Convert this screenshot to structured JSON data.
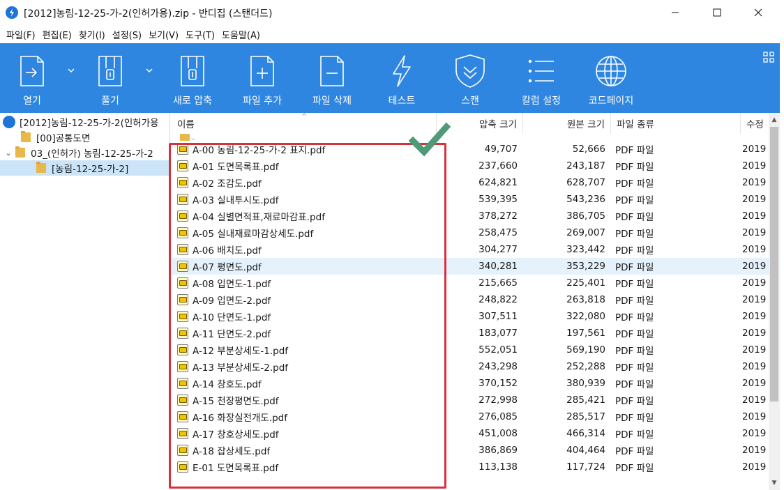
{
  "window": {
    "title": "[2012]농림-12-25-가-2(인허가용).zip - 반디집 (스탠더드)"
  },
  "menu": [
    "파일(F)",
    "편집(E)",
    "찾기(I)",
    "설정(S)",
    "보기(V)",
    "도구(T)",
    "도움말(A)"
  ],
  "toolbar": {
    "open": "열기",
    "extract": "풀기",
    "new_archive": "새로 압축",
    "add_file": "파일 추가",
    "delete_file": "파일 삭제",
    "test": "테스트",
    "scan": "스캔",
    "column_settings": "칼럼 설정",
    "codepage": "코드페이지"
  },
  "tree": {
    "root": "[2012]농림-12-25-가-2(인허가용",
    "items": [
      "[00]공통도면",
      "03_(인허가) 농림-12-25-가-2",
      "[농림-12-25-가-2]"
    ]
  },
  "columns": {
    "name": "이름",
    "compressed": "압축 크기",
    "original": "원본 크기",
    "type": "파일 종류",
    "modified": "수정"
  },
  "parent_label": "..",
  "files": [
    {
      "name": "A-00 농림-12-25-가-2 표지.pdf",
      "comp": "49,707",
      "orig": "52,666",
      "type": "PDF 파일",
      "mod": "2019"
    },
    {
      "name": "A-01 도면목록표.pdf",
      "comp": "237,660",
      "orig": "243,187",
      "type": "PDF 파일",
      "mod": "2019"
    },
    {
      "name": "A-02 조감도.pdf",
      "comp": "624,821",
      "orig": "628,707",
      "type": "PDF 파일",
      "mod": "2019"
    },
    {
      "name": "A-03 실내투시도.pdf",
      "comp": "539,395",
      "orig": "543,236",
      "type": "PDF 파일",
      "mod": "2019"
    },
    {
      "name": "A-04 실별면적표,재료마감표.pdf",
      "comp": "378,272",
      "orig": "386,705",
      "type": "PDF 파일",
      "mod": "2019"
    },
    {
      "name": "A-05 실내재료마감상세도.pdf",
      "comp": "258,475",
      "orig": "269,007",
      "type": "PDF 파일",
      "mod": "2019"
    },
    {
      "name": "A-06 배치도.pdf",
      "comp": "304,277",
      "orig": "323,442",
      "type": "PDF 파일",
      "mod": "2019"
    },
    {
      "name": "A-07 평면도.pdf",
      "comp": "340,281",
      "orig": "353,229",
      "type": "PDF 파일",
      "mod": "2019"
    },
    {
      "name": "A-08 입면도-1.pdf",
      "comp": "215,665",
      "orig": "225,401",
      "type": "PDF 파일",
      "mod": "2019"
    },
    {
      "name": "A-09 입면도-2.pdf",
      "comp": "248,822",
      "orig": "263,818",
      "type": "PDF 파일",
      "mod": "2019"
    },
    {
      "name": "A-10 단면도-1.pdf",
      "comp": "307,511",
      "orig": "322,080",
      "type": "PDF 파일",
      "mod": "2019"
    },
    {
      "name": "A-11 단면도-2.pdf",
      "comp": "183,077",
      "orig": "197,561",
      "type": "PDF 파일",
      "mod": "2019"
    },
    {
      "name": "A-12 부분상세도-1.pdf",
      "comp": "552,051",
      "orig": "569,190",
      "type": "PDF 파일",
      "mod": "2019"
    },
    {
      "name": "A-13 부분상세도-2.pdf",
      "comp": "243,298",
      "orig": "252,288",
      "type": "PDF 파일",
      "mod": "2019"
    },
    {
      "name": "A-14 창호도.pdf",
      "comp": "370,152",
      "orig": "380,939",
      "type": "PDF 파일",
      "mod": "2019"
    },
    {
      "name": "A-15 천장평면도.pdf",
      "comp": "272,998",
      "orig": "285,421",
      "type": "PDF 파일",
      "mod": "2019"
    },
    {
      "name": "A-16 화장실전개도.pdf",
      "comp": "276,085",
      "orig": "285,517",
      "type": "PDF 파일",
      "mod": "2019"
    },
    {
      "name": "A-17 창호상세도.pdf",
      "comp": "451,008",
      "orig": "466,314",
      "type": "PDF 파일",
      "mod": "2019"
    },
    {
      "name": "A-18 잡상세도.pdf",
      "comp": "386,869",
      "orig": "404,464",
      "type": "PDF 파일",
      "mod": "2019"
    },
    {
      "name": "E-01 도면목록표.pdf",
      "comp": "113,138",
      "orig": "117,724",
      "type": "PDF 파일",
      "mod": "2019"
    }
  ],
  "highlighted_file": "A-07 평면도.pdf",
  "colors": {
    "toolbar": "#2f86e0",
    "selection": "#cce4f7",
    "highlight_row": "#e5f1fb",
    "annotation_red": "#d9313a",
    "annotation_check": "#4f9a78"
  }
}
